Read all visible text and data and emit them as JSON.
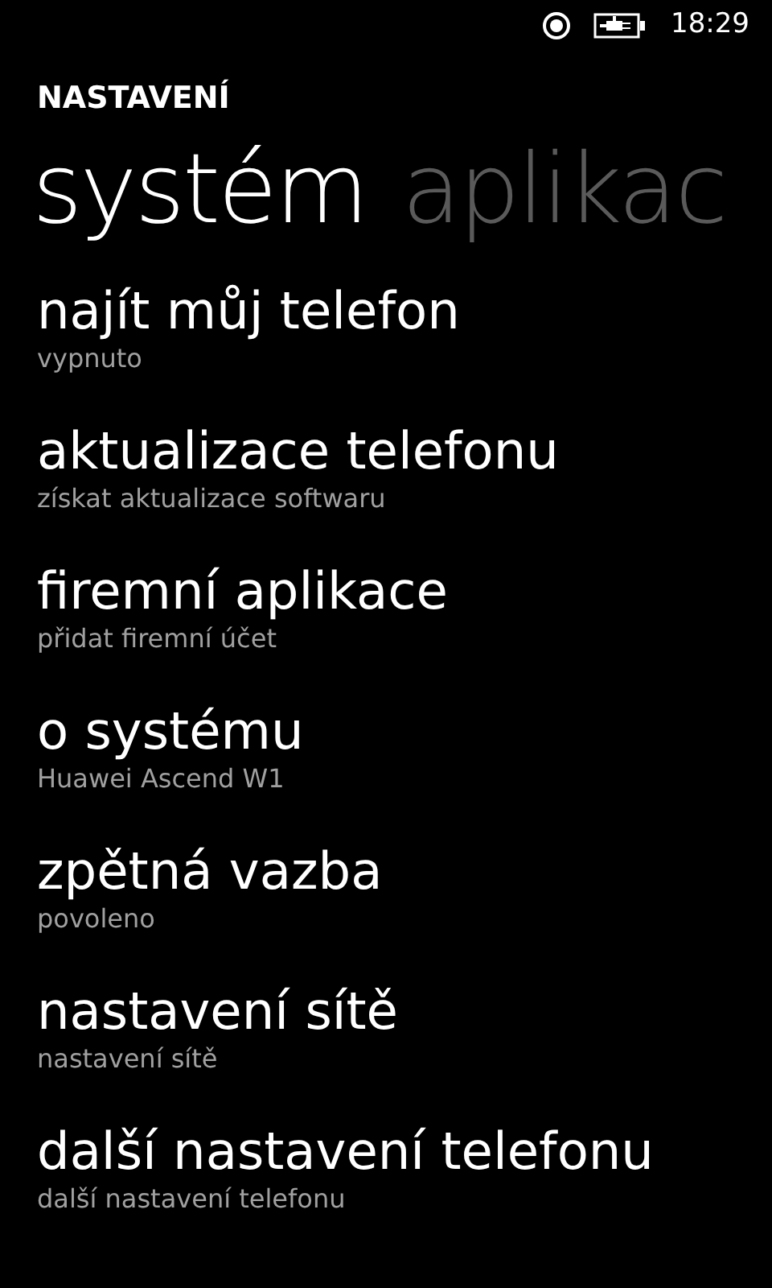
{
  "status_bar": {
    "time": "18:29"
  },
  "app_title": "NASTAVENÍ",
  "pivots": [
    {
      "label": "systém",
      "selected": true
    },
    {
      "label": "aplikac",
      "selected": false
    }
  ],
  "items": [
    {
      "title": "najít můj telefon",
      "subtitle": "vypnuto"
    },
    {
      "title": "aktualizace telefonu",
      "subtitle": "získat aktualizace softwaru"
    },
    {
      "title": "firemní aplikace",
      "subtitle": "přidat firemní účet"
    },
    {
      "title": "o systému",
      "subtitle": "Huawei Ascend W1"
    },
    {
      "title": "zpětná vazba",
      "subtitle": "povoleno"
    },
    {
      "title": "nastavení sítě",
      "subtitle": "nastavení sítě"
    },
    {
      "title": "další nastavení telefonu",
      "subtitle": "další nastavení telefonu"
    }
  ]
}
